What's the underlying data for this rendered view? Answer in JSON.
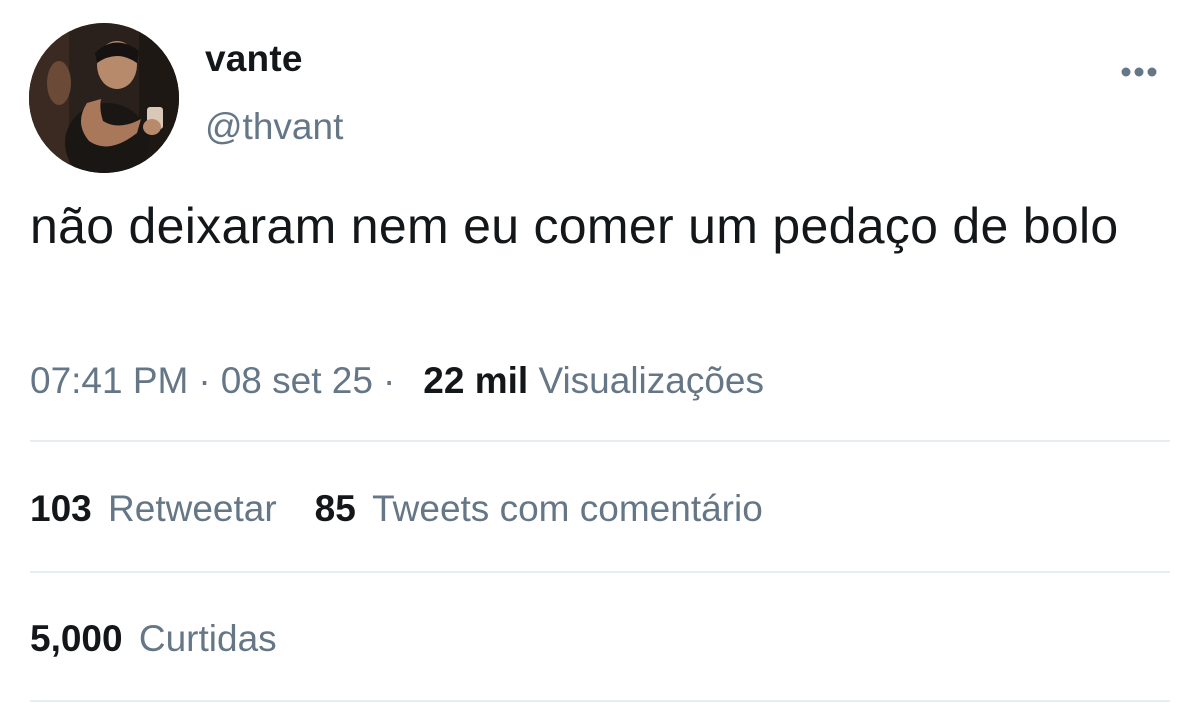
{
  "user": {
    "display_name": "vante",
    "handle": "@thvant"
  },
  "icons": {
    "more": "more-options-icon",
    "avatar": "profile-photo"
  },
  "tweet": {
    "text": "não deixaram nem eu comer um pedaço de bolo",
    "time": "07:41 PM",
    "separator": "·",
    "date": "08 set 25",
    "views_count": "22 mil",
    "views_label": "Visualizações"
  },
  "stats": {
    "retweets_count": "103",
    "retweets_label": "Retweetar",
    "quotes_count": "85",
    "quotes_label": "Tweets com comentário",
    "likes_count": "5,000",
    "likes_label": "Curtidas"
  },
  "colors": {
    "primary_text": "#14171a",
    "secondary_text": "#657786",
    "divider": "#e6ecf0"
  }
}
